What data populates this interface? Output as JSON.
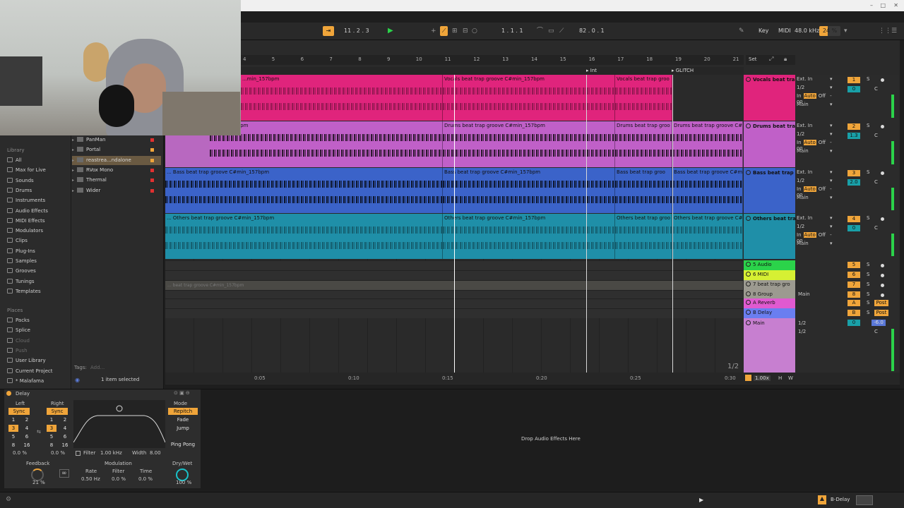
{
  "transport": {
    "tempo_pos": "11 .  2 .  3",
    "song_pos": "1 .  1 .  1",
    "zoom": "82 .  0 .  1",
    "key_label": "Key",
    "midi_label": "MIDI",
    "sample_rate": "48.0 kHz",
    "cpu": "24 %"
  },
  "library": {
    "header": "Library",
    "items": [
      "All",
      "Max for Live",
      "Sounds",
      "Drums",
      "Instruments",
      "Audio Effects",
      "MIDI Effects",
      "Modulators",
      "Clips",
      "Plug-Ins",
      "Samples",
      "Grooves",
      "Tunings",
      "Templates"
    ],
    "places_header": "Places",
    "places": [
      "Packs",
      "Splice",
      "Cloud",
      "Push",
      "User Library",
      "Current Project",
      "* Malafama"
    ],
    "plugins": [
      "PanMan",
      "Portal",
      "reastrea...ndalone",
      "RVox Mono",
      "Thermal",
      "Wider"
    ],
    "tags_label": "Tags:",
    "tags_add": "Add...",
    "selection": "1 item selected"
  },
  "ruler": {
    "bars": [
      "4",
      "5",
      "6",
      "7",
      "8",
      "9",
      "10",
      "11",
      "12",
      "13",
      "14",
      "15",
      "16",
      "17",
      "18",
      "19",
      "20",
      "21"
    ],
    "set_label": "Set",
    "locators": [
      "Int",
      "GLITCH"
    ]
  },
  "tracks": [
    {
      "name": "Vocals beat tra",
      "color": "#e0247c",
      "clips": [
        "...min_157bpm",
        "Vocals beat trap groove C#min_157bpm",
        "Vocals beat trap groo"
      ],
      "io_in": "Ext. In",
      "io_ch": "1/2",
      "out": "Main",
      "num": "1",
      "vol": "0"
    },
    {
      "name": "Drums beat tra",
      "color": "#c060c8",
      "clips": [
        "...min_157bpm",
        "Drums beat trap groove C#min_157bpm",
        "Drums beat trap groo",
        "Drums beat trap groove C#"
      ],
      "io_in": "Ext. In",
      "io_ch": "1/2",
      "out": "Main",
      "num": "2",
      "vol": "1.3"
    },
    {
      "name": "Bass beat trap",
      "color": "#3b63c9",
      "clips": [
        "... Bass beat trap groove C#min_157bpm",
        "Bass beat trap groove C#min_157bpm",
        "Bass beat trap groo",
        "Bass beat trap groove C#m"
      ],
      "io_in": "Ext. In",
      "io_ch": "1/2",
      "out": "Main",
      "num": "3",
      "vol": "2.0"
    },
    {
      "name": "Others beat tra",
      "color": "#1f8fa8",
      "clips": [
        "... Others beat trap groove C#min_157bpm",
        "Others beat trap groove C#min_157bpm",
        "Others beat trap groo",
        "Others beat trap groove C#"
      ],
      "io_in": "Ext. In",
      "io_ch": "1/2",
      "out": "Main",
      "num": "4",
      "vol": "0"
    }
  ],
  "small_tracks": [
    {
      "name": "5 Audio",
      "color": "#2bd34a",
      "num": "5"
    },
    {
      "name": "6 MIDI",
      "color": "#d6f033",
      "num": "6"
    },
    {
      "name": "7 beat trap gro",
      "color": "#9c9a90",
      "num": "7",
      "clip": "... beat trap groove C#min_157bpm"
    },
    {
      "name": "8 Group",
      "color": "#9c9a90",
      "num": "8"
    },
    {
      "name": "A Reverb",
      "color": "#e05ad0",
      "num": "A"
    },
    {
      "name": "B Delay",
      "color": "#6a7ef0",
      "num": "B"
    }
  ],
  "main": {
    "name": "Main",
    "vol": "0",
    "db": "-6.0",
    "io_ch": "1/2",
    "pan": "C"
  },
  "common": {
    "auto": "Auto",
    "off": "Off",
    "in": "In",
    "s": "S",
    "post": "Post",
    "c": "C",
    "ch2": "1/2",
    "io_dash": "-oo",
    "main_out": "Main"
  },
  "page_indicator": "1/2",
  "timeline": {
    "labels": [
      "0:05",
      "0:10",
      "0:15",
      "0:20",
      "0:25",
      "0:30"
    ],
    "zoom": "1.00x",
    "h": "H",
    "w": "W"
  },
  "delay": {
    "title": "Delay",
    "left": "Left",
    "right": "Right",
    "sync": "Sync",
    "mode": "Mode",
    "repitch": "Repitch",
    "fade": "Fade",
    "jump": "Jump",
    "ping_pong": "Ping Pong",
    "steps": [
      "1",
      "2",
      "3",
      "4",
      "5",
      "6",
      "8",
      "16"
    ],
    "left_pct": "0.0 %",
    "right_pct": "0.0 %",
    "filter_label": "Filter",
    "filter_freq": "1.00 kHz",
    "width_label": "Width",
    "width_val": "8.00",
    "feedback": "Feedback",
    "feedback_val": "21 %",
    "modulation": "Modulation",
    "rate": "Rate",
    "rate_val": "0.50 Hz",
    "mod_filter": "Filter",
    "mod_filter_val": "0.0 %",
    "time": "Time",
    "time_val": "0.0 %",
    "drywet": "Dry/Wet",
    "drywet_val": "100 %"
  },
  "drop_hint": "Drop Audio Effects Here",
  "status": {
    "device": "B-Delay"
  },
  "colors": {
    "accent": "#f0a53a",
    "green": "#2bd34a"
  }
}
